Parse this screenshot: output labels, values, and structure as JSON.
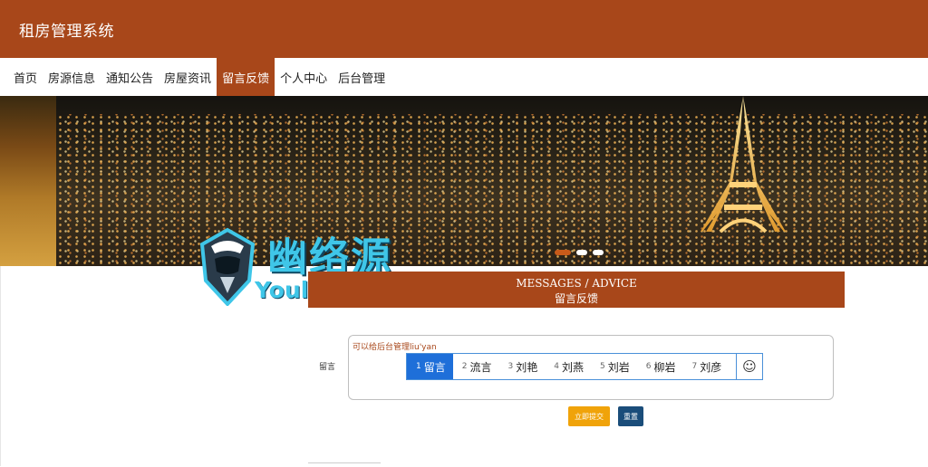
{
  "header": {
    "title": "租房管理系统",
    "bg_color": "#a8471a"
  },
  "nav": {
    "items": [
      {
        "label": "首页"
      },
      {
        "label": "房源信息"
      },
      {
        "label": "通知公告"
      },
      {
        "label": "房屋资讯"
      },
      {
        "label": "留言反馈",
        "active": true
      },
      {
        "label": "个人中心"
      },
      {
        "label": "后台管理"
      }
    ]
  },
  "banner": {
    "image": "paris-night-eiffel-tower",
    "indicators": 3,
    "active_indicator": 0
  },
  "watermark": {
    "cn": "幽络源",
    "en": "Youluoyuan"
  },
  "section": {
    "title_en": "MESSAGES / ADVICE",
    "title_cn": "留言反馈"
  },
  "form": {
    "label": "留言",
    "placeholder": "可以给后台管理liu'yan",
    "ime": {
      "candidates": [
        {
          "n": "1",
          "text": "留言",
          "active": true
        },
        {
          "n": "2",
          "text": "流言"
        },
        {
          "n": "3",
          "text": "刘艳"
        },
        {
          "n": "4",
          "text": "刘燕"
        },
        {
          "n": "5",
          "text": "刘岩"
        },
        {
          "n": "6",
          "text": "柳岩"
        },
        {
          "n": "7",
          "text": "刘彦"
        }
      ],
      "emoji": "☺"
    },
    "submit_label": "立即提交",
    "reset_label": "重置"
  }
}
